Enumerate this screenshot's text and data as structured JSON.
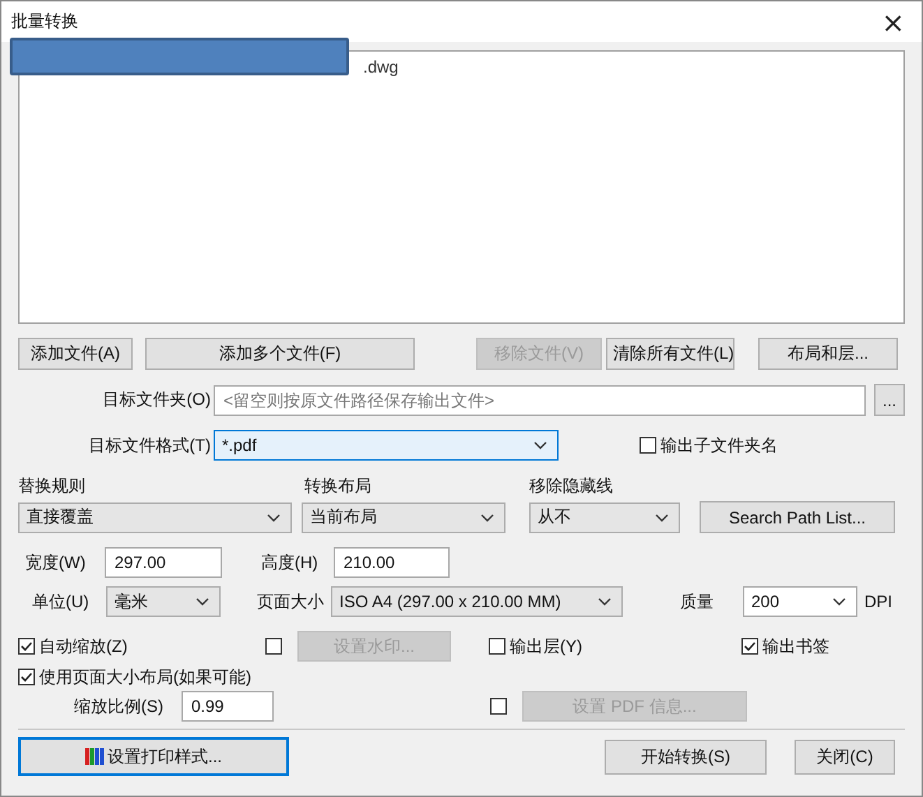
{
  "window": {
    "title": "批量转换",
    "close": "×"
  },
  "file_list": {
    "items": [
      ".dwg"
    ]
  },
  "file_buttons": [
    {
      "label": "添加文件(A)",
      "disabled": false
    },
    {
      "label": "添加多个文件(F)",
      "disabled": false
    },
    {
      "label": "移除文件(V)",
      "disabled": true
    },
    {
      "label": "清除所有文件(L)",
      "disabled": false
    },
    {
      "label": "布局和层...",
      "disabled": false
    }
  ],
  "target_folder": {
    "label": "目标文件夹(O)",
    "placeholder": "<留空则按原文件路径保存输出文件>",
    "browse": "..."
  },
  "target_format": {
    "label": "目标文件格式(T)",
    "value": "*.pdf",
    "focused": true
  },
  "subfolder": {
    "label": "输出子文件夹名",
    "checked": false
  },
  "replace_rule": {
    "label": "替换规则",
    "value": "直接覆盖"
  },
  "convert_layout": {
    "label": "转换布局",
    "value": "当前布局"
  },
  "hidden_lines": {
    "label": "移除隐藏线",
    "value": "从不"
  },
  "search_path_button": "Search Path List...",
  "width": {
    "label": "宽度(W)",
    "value": "297.00"
  },
  "height": {
    "label": "高度(H)",
    "value": "210.00"
  },
  "unit": {
    "label": "单位(U)",
    "value": "毫米"
  },
  "page_size": {
    "label": "页面大小",
    "value": "ISO A4 (297.00 x 210.00 MM)"
  },
  "quality": {
    "label": "质量",
    "value": "200",
    "suffix": "DPI"
  },
  "auto_scale": {
    "label": "自动缩放(Z)",
    "checked": true
  },
  "watermark": {
    "checked": false,
    "button": "设置水印...",
    "disabled": true
  },
  "output_layers": {
    "label": "输出层(Y)",
    "checked": false
  },
  "output_bookmarks": {
    "label": "输出书签",
    "checked": true
  },
  "use_page_size_layout": {
    "label": "使用页面大小布局(如果可能)",
    "checked": true
  },
  "scale": {
    "label": "缩放比例(S)",
    "value": "0.99"
  },
  "pdf_info": {
    "checked": false,
    "button": "设置 PDF 信息...",
    "disabled": true
  },
  "print_style_button": {
    "label": "设置打印样式...",
    "focused": true
  },
  "start_button": "开始转换(S)",
  "close_button": "关闭(C)"
}
